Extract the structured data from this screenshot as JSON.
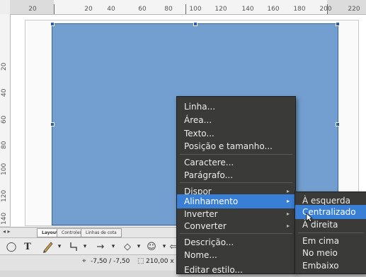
{
  "ruler": {
    "h_ticks": [
      "20",
      "20",
      "40",
      "60",
      "80",
      "100",
      "120",
      "140",
      "160",
      "180",
      "200",
      "220"
    ],
    "v_ticks": [
      "20",
      "40",
      "60",
      "80",
      "100",
      "120",
      "140"
    ]
  },
  "tabs": {
    "layout": "Layout",
    "controls": "Controles",
    "dimension_lines": "Linhas de cota"
  },
  "status": {
    "position": "-7,50 / -7,50",
    "size": "210,00 x 1"
  },
  "context_menu": {
    "line": "Linha...",
    "area": "Área...",
    "text": "Texto...",
    "position_size": "Posição e tamanho...",
    "character": "Caractere...",
    "paragraph": "Parágrafo...",
    "arrange": "Dispor",
    "alignment": "Alinhamento",
    "flip": "Inverter",
    "convert": "Converter",
    "description": "Descrição...",
    "name": "Nome...",
    "edit_style": "Editar estilo..."
  },
  "submenu": {
    "left": "À esquerda",
    "centered": "Centralizado",
    "right": "À direita",
    "top": "Em cima",
    "middle": "No meio",
    "bottom": "Embaixo"
  },
  "colors": {
    "shape_fill": "#729fcf",
    "menu_bg": "#3a3a38",
    "menu_highlight": "#3a7fd6"
  }
}
